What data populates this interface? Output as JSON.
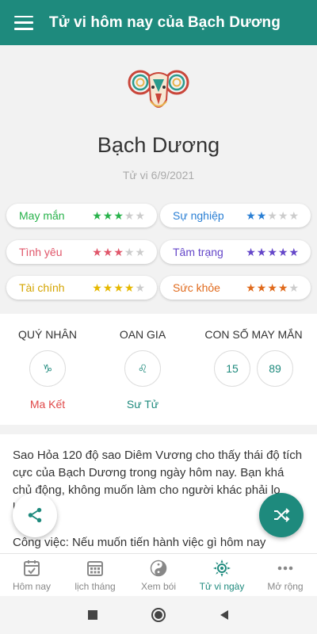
{
  "appbar": {
    "title": "Tử vi hôm nay của Bạch Dương"
  },
  "sign": {
    "name": "Bạch Dương",
    "date": "Tử vi 6/9/2021"
  },
  "ratings": [
    {
      "label": "May mắn",
      "stars": 3,
      "color": "#27b24a"
    },
    {
      "label": "Sự nghiệp",
      "stars": 2,
      "color": "#2a7fd4"
    },
    {
      "label": "Tình yêu",
      "stars": 3,
      "color": "#e0566a"
    },
    {
      "label": "Tâm trạng",
      "stars": 5,
      "color": "#6446c9"
    },
    {
      "label": "Tài chính",
      "stars": 4,
      "color": "#e6b800"
    },
    {
      "label": "Sức khỏe",
      "stars": 4,
      "color": "#e06a1c"
    }
  ],
  "info": {
    "quy_nhan": {
      "title": "QUÝ NHÂN",
      "symbol": "♑",
      "name": "Ma Kết",
      "color": "#e04848"
    },
    "oan_gia": {
      "title": "OAN GIA",
      "symbol": "♌",
      "name": "Sư Tử",
      "color": "#1e8a7d"
    },
    "lucky": {
      "title": "CON SỐ MAY MẮN",
      "numbers": [
        "15",
        "89"
      ]
    }
  },
  "content": {
    "paragraph1": "Sao Hỏa 120 độ sao Diêm Vương cho thấy thái độ tích cực của Bạch Dương trong ngày hôm nay. Bạn khá chủ động, không muốn làm cho người khác phải lo lắng.",
    "paragraph2": "Công việc: Nếu muốn tiến hành việc gì hôm nay"
  },
  "nav": [
    {
      "label": "Hôm nay",
      "icon": "calendar-check-icon",
      "active": false
    },
    {
      "label": "lịch tháng",
      "icon": "calendar-grid-icon",
      "active": false
    },
    {
      "label": "Xem bói",
      "icon": "yin-yang-icon",
      "active": false
    },
    {
      "label": "Tử vi ngày",
      "icon": "sun-compass-icon",
      "active": true
    },
    {
      "label": "Mở rộng",
      "icon": "more-dots-icon",
      "active": false
    }
  ],
  "colors": {
    "primary": "#1e8a7d",
    "background": "#f2f2f2"
  }
}
